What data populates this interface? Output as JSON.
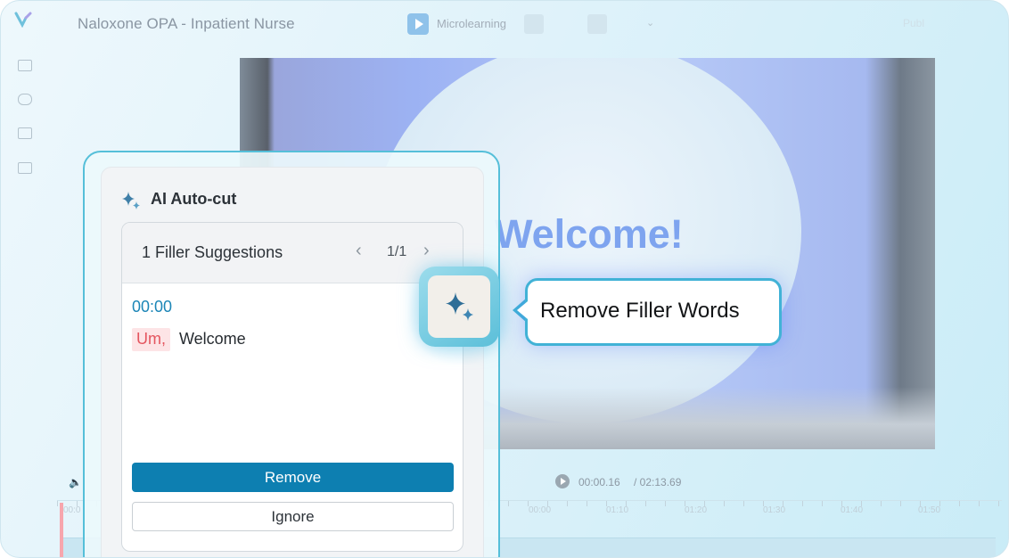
{
  "app": {
    "title": "Naloxone OPA - Inpatient Nurse",
    "mode_label": "Microlearning",
    "header_right": "Publ",
    "colors": {
      "accent": "#0d7fb1",
      "highlight_border": "#41b2d6",
      "filler_text": "#e4555f",
      "filler_bg": "#fde4e6"
    }
  },
  "sidebar": {
    "items": [
      {
        "icon": "captions-icon"
      },
      {
        "icon": "shapes-icon"
      },
      {
        "icon": "avatar-icon"
      },
      {
        "icon": "comment-icon"
      }
    ]
  },
  "canvas": {
    "slide_text": "Welcome!"
  },
  "timeline": {
    "current_time": "00:00.16",
    "total_time": "/ 02:13.69",
    "ticks": [
      "00:0",
      "00:00",
      "01:10",
      "01:20",
      "01:30",
      "01:40",
      "01:50"
    ]
  },
  "ai_panel": {
    "title": "AI Auto-cut",
    "suggestions_title": "1 Filler Suggestions",
    "pager": "1/1",
    "prev_icon": "‹",
    "next_icon": "›",
    "timestamp": "00:00",
    "filler_word": "Um,",
    "transcript_rest": "Welcome",
    "remove_label": "Remove",
    "ignore_label": "Ignore"
  },
  "tooltip": {
    "text": "Remove Filler Words"
  }
}
